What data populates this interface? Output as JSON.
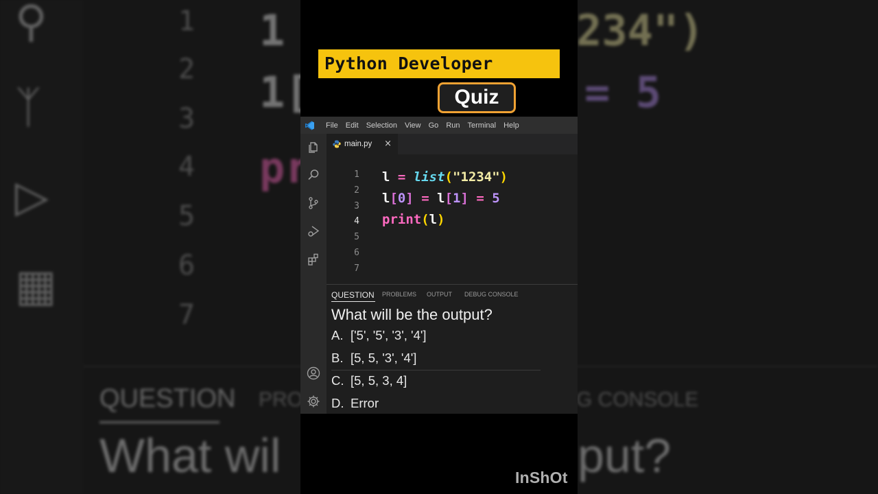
{
  "banner": {
    "title": "Python Developer",
    "badge": "Quiz"
  },
  "menubar": {
    "items": [
      "File",
      "Edit",
      "Selection",
      "View",
      "Go",
      "Run",
      "Terminal",
      "Help"
    ]
  },
  "activity_bar": {
    "icons": [
      "explorer-icon",
      "search-icon",
      "source-control-icon",
      "run-debug-icon",
      "extensions-icon",
      "account-icon",
      "settings-gear-icon"
    ]
  },
  "editor": {
    "tab": {
      "label": "main.py",
      "close": "×"
    },
    "line_numbers": [
      "1",
      "2",
      "3",
      "4",
      "5",
      "6",
      "7"
    ],
    "active_line": 4,
    "lines": [
      {
        "tokens": [
          "l",
          " = ",
          "list",
          "(",
          "\"1234\"",
          ")"
        ]
      },
      {
        "tokens": [
          "l",
          "[",
          "0",
          "]",
          " = ",
          "l",
          "[",
          "1",
          "]",
          " = ",
          "5"
        ]
      },
      {
        "tokens": [
          "print",
          "(",
          "l",
          ")"
        ]
      }
    ]
  },
  "panel": {
    "tabs": [
      "QUESTION",
      "PROBLEMS",
      "OUTPUT",
      "DEBUG CONSOLE"
    ],
    "active_tab": "QUESTION",
    "question": "What will be the output?",
    "options": [
      {
        "letter": "A.",
        "text": "['5', '5', '3', '4']"
      },
      {
        "letter": "B.",
        "text": "[5, 5, '3', '4']"
      },
      {
        "letter": "C.",
        "text": "[5, 5, 3, 4]"
      },
      {
        "letter": "D.",
        "text": "Error"
      }
    ]
  },
  "background": {
    "line_numbers": [
      "1",
      "2",
      "3",
      "4",
      "5",
      "6",
      "7"
    ],
    "code_fragments": [
      "1",
      "234\")",
      "1[",
      "= 5",
      "pr"
    ],
    "tabs": [
      "QUESTION",
      "PRO",
      "G CONSOLE"
    ],
    "question_fragments": [
      "What wil",
      "put?"
    ]
  },
  "watermark": "InShOt",
  "colors": {
    "banner_yellow": "#f6c30e",
    "badge_border": "#f0a233",
    "editor_bg": "#1e1e1e",
    "operator_pink": "#ff6ac1",
    "function_cyan": "#66d9ef",
    "string_yellow": "#f3eca6",
    "number_purple": "#bd93f9"
  }
}
